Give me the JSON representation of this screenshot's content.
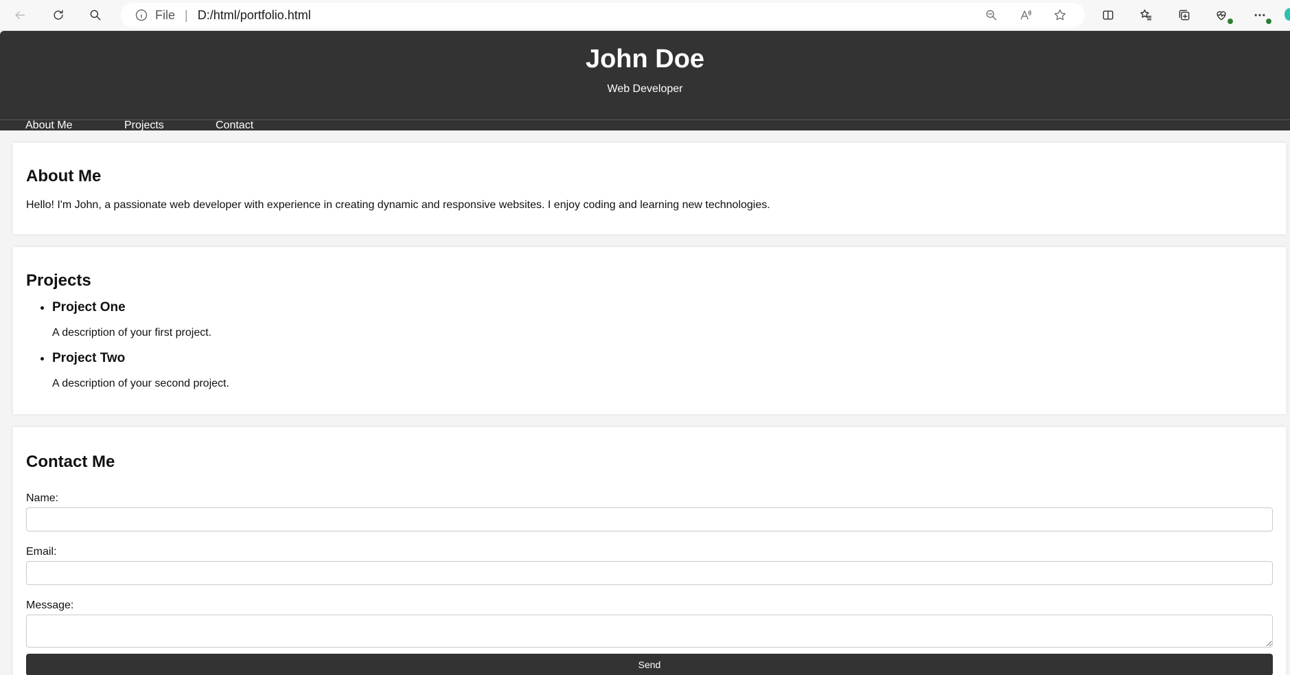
{
  "browser": {
    "address_scheme": "File",
    "address_separator": "|",
    "address_url": "D:/html/portfolio.html"
  },
  "header": {
    "title": "John Doe",
    "subtitle": "Web Developer"
  },
  "nav": {
    "items": [
      "About Me",
      "Projects",
      "Contact"
    ]
  },
  "about": {
    "heading": "About Me",
    "text": "Hello! I'm John, a passionate web developer with experience in creating dynamic and responsive websites. I enjoy coding and learning new technologies."
  },
  "projects": {
    "heading": "Projects",
    "items": [
      {
        "title": "Project One",
        "description": "A description of your first project."
      },
      {
        "title": "Project Two",
        "description": "A description of your second project."
      }
    ]
  },
  "contact": {
    "heading": "Contact Me",
    "name_label": "Name:",
    "name_value": "",
    "email_label": "Email:",
    "email_value": "",
    "message_label": "Message:",
    "message_value": "",
    "send_label": "Send"
  },
  "colors": {
    "header_bg": "#333333",
    "page_bg": "#f4f4f4",
    "card_bg": "#ffffff",
    "button_bg": "#333333",
    "notification_badge": "#2e7d32"
  },
  "icons": [
    "back-arrow-icon",
    "refresh-icon",
    "search-icon",
    "info-icon",
    "zoom-out-icon",
    "read-aloud-icon",
    "star-icon",
    "split-screen-icon",
    "favorites-icon",
    "collections-icon",
    "health-icon",
    "more-icon"
  ]
}
